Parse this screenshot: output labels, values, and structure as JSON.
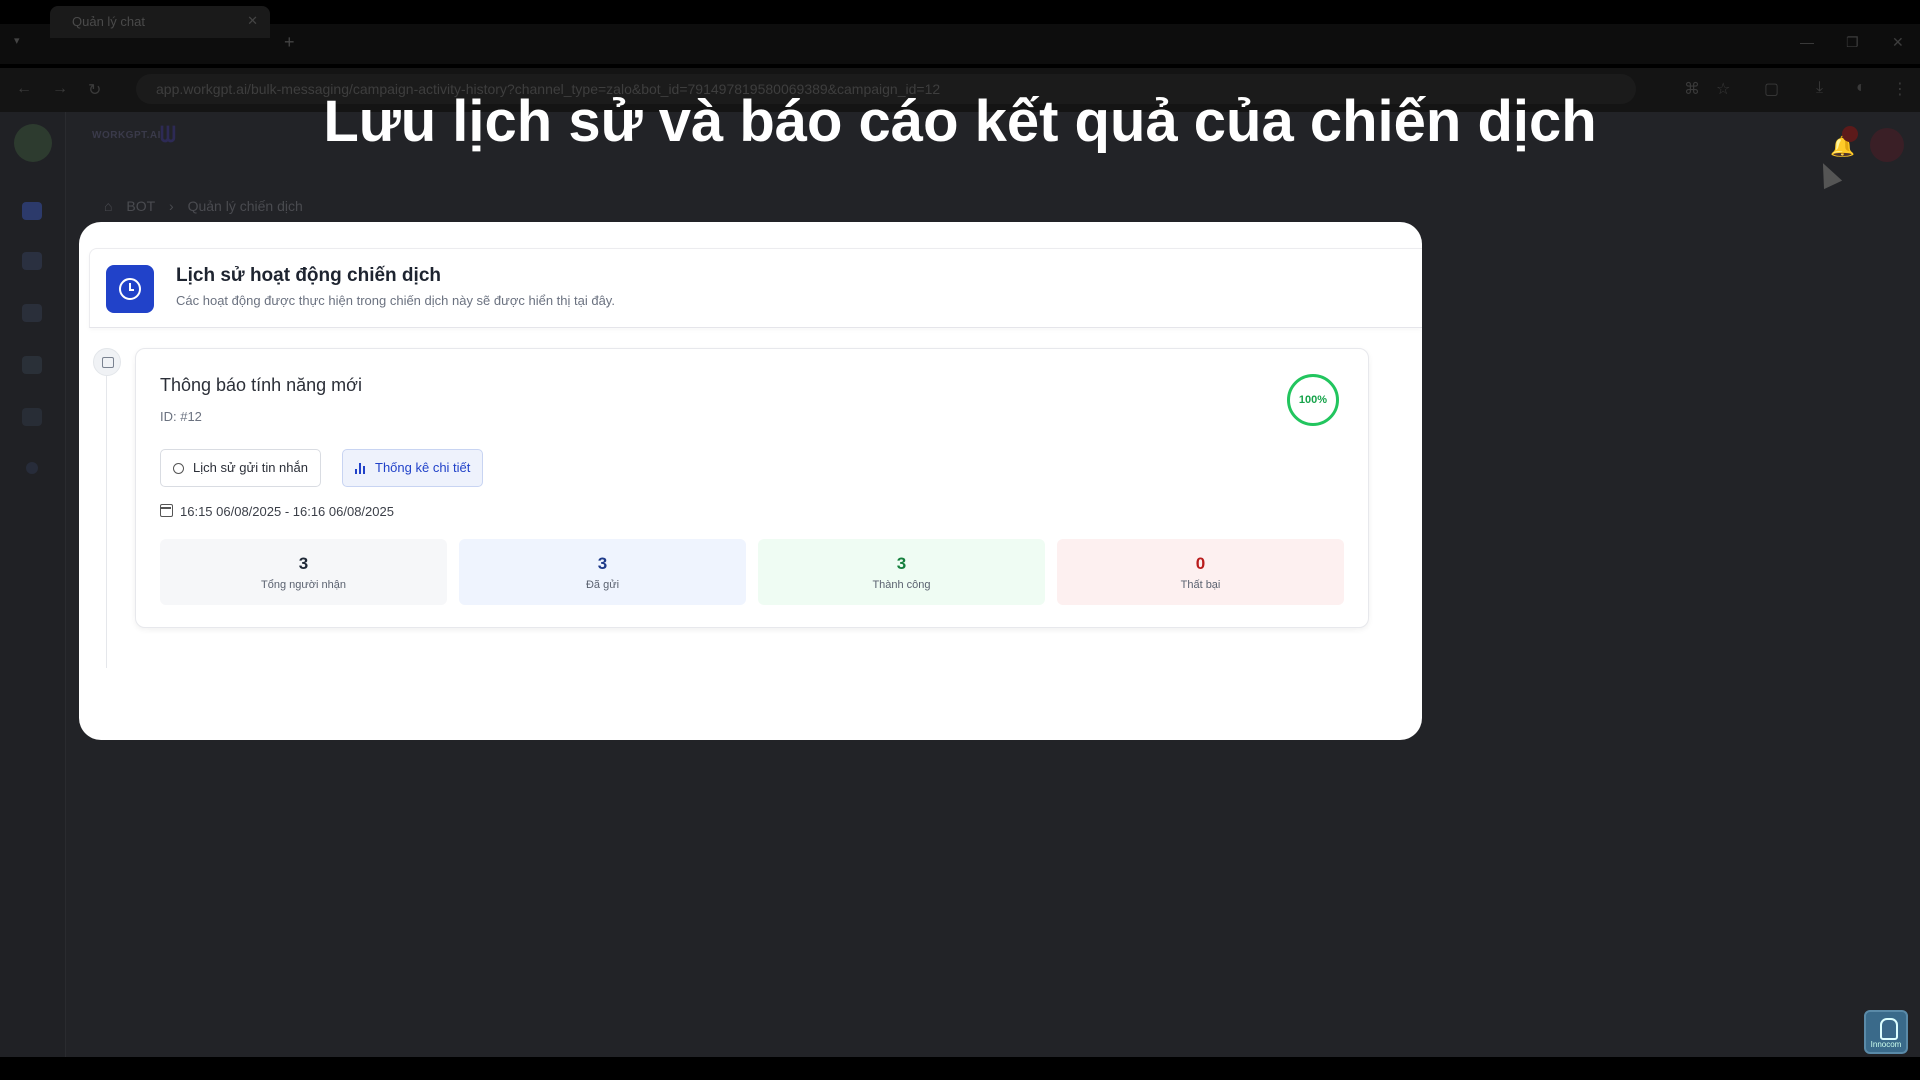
{
  "headline": "Lưu lịch sử và báo cáo kết quả của chiến dịch",
  "browser": {
    "tab_title": "Quản lý chat",
    "url": "app.workgpt.ai/bulk-messaging/campaign-activity-history?channel_type=zalo&bot_id=791497819580069389&campaign_id=12"
  },
  "app": {
    "logo_text": "WORKGPT.AI",
    "breadcrumb": [
      "BOT",
      "Quản lý chiến dịch"
    ]
  },
  "modal": {
    "title": "Lịch sử hoạt động chiến dịch",
    "subtitle": "Các hoạt động được thực hiện trong chiến dịch này sẽ được hiển thị tại đây.",
    "campaign": {
      "name": "Thông báo tính năng mới",
      "id_label": "ID: #12",
      "progress": "100%",
      "history_button": "Lịch sử gửi tin nhắn",
      "stats_button": "Thống kê chi tiết",
      "date_range": "16:15 06/08/2025 - 16:16 06/08/2025",
      "stats": [
        {
          "value": "3",
          "label": "Tổng người nhận",
          "color": "#1f2937",
          "bg": "#f6f7f9"
        },
        {
          "value": "3",
          "label": "Đã gửi",
          "color": "#1e3a8a",
          "bg": "#eff4fe"
        },
        {
          "value": "3",
          "label": "Thành công",
          "color": "#15803d",
          "bg": "#effcf3"
        },
        {
          "value": "0",
          "label": "Thất bại",
          "color": "#b91c1c",
          "bg": "#fdf0f0"
        }
      ]
    }
  },
  "watermark": "Innocom"
}
